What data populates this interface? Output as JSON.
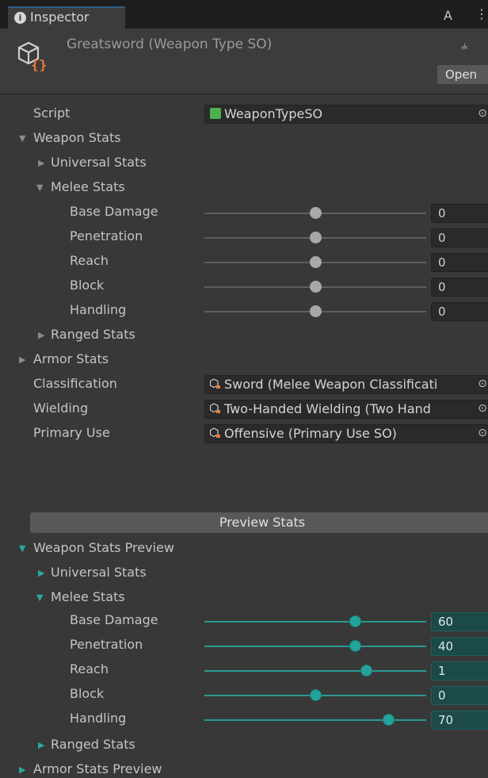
{
  "tab": {
    "label": "Inspector",
    "info_icon": "i"
  },
  "header": {
    "title": "Greatsword (Weapon Type SO)",
    "open_label": "Open"
  },
  "script_row": {
    "label": "Script",
    "value": "WeaponTypeSO"
  },
  "weapon_stats": {
    "label": "Weapon Stats",
    "universal_label": "Universal Stats",
    "melee_label": "Melee Stats",
    "ranged_label": "Ranged Stats",
    "melee_fields": [
      {
        "label": "Base Damage",
        "value": "0",
        "fraction": 0.5
      },
      {
        "label": "Penetration",
        "value": "0",
        "fraction": 0.5
      },
      {
        "label": "Reach",
        "value": "0",
        "fraction": 0.5
      },
      {
        "label": "Block",
        "value": "0",
        "fraction": 0.5
      },
      {
        "label": "Handling",
        "value": "0",
        "fraction": 0.5
      }
    ]
  },
  "armor_stats_label": "Armor Stats",
  "object_fields": [
    {
      "label": "Classification",
      "value": "Sword (Melee Weapon Classificati"
    },
    {
      "label": "Wielding",
      "value": "Two-Handed Wielding (Two Hand"
    },
    {
      "label": "Primary Use",
      "value": "Offensive (Primary Use SO)"
    }
  ],
  "preview_button_label": "Preview Stats",
  "weapon_stats_preview": {
    "label": "Weapon Stats Preview",
    "universal_label": "Universal Stats",
    "melee_label": "Melee Stats",
    "ranged_label": "Ranged Stats",
    "melee_fields": [
      {
        "label": "Base Damage",
        "value": "60",
        "fraction": 0.68
      },
      {
        "label": "Penetration",
        "value": "40",
        "fraction": 0.68
      },
      {
        "label": "Reach",
        "value": "1",
        "fraction": 0.73
      },
      {
        "label": "Block",
        "value": "0",
        "fraction": 0.5
      },
      {
        "label": "Handling",
        "value": "70",
        "fraction": 0.83
      }
    ]
  },
  "armor_stats_preview_label": "Armor Stats Preview",
  "colors": {
    "background": "#383838",
    "teal_accent": "#24a39c",
    "teal_field": "#1c4a49",
    "script_icon": "#4caf50",
    "so_icon_orange": "#e8793a"
  }
}
